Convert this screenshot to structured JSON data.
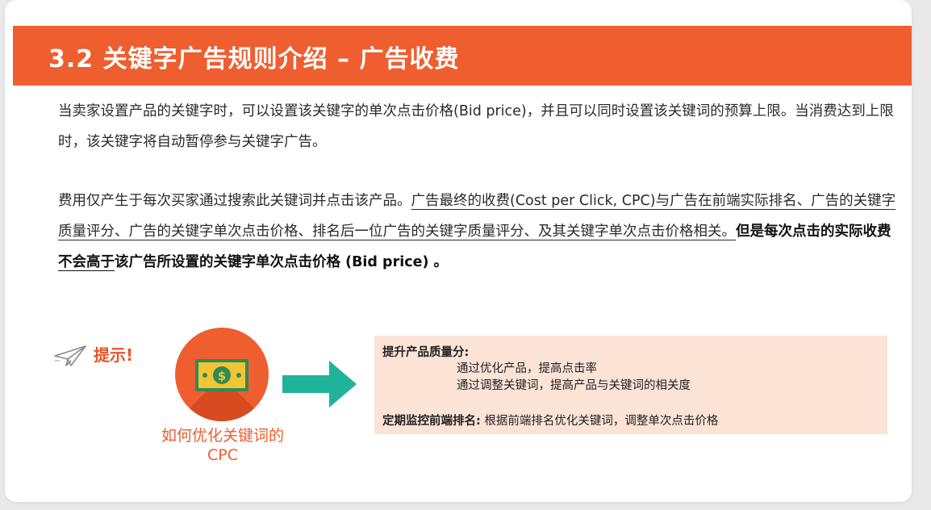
{
  "slide": {
    "title": "3.2 关键字广告规则介绍 – 广告收费",
    "paragraph1": "当卖家设置产品的关键字时，可以设置该关键字的单次点击价格(Bid price)，并且可以同时设置该关键词的预算上限。当消费达到上限时，该关键字将自动暂停参与关键字广告。",
    "paragraph2": {
      "plain": "费用仅产生于每次买家通过搜索此关键词并点击该产品。",
      "underlined": "广告最终的收费(Cost per Click, CPC)与广告在前端实际排名、广告的关键字质量评分、广告的关键字单次点击价格、排名后一位广告的关键字质量评分、及其关键字单次点击价格相关。",
      "bold_a": "但是每次点击的实际收费",
      "bold_underlined": "不会高于",
      "bold_b": "该广告所设置的关键字单次点击价格 (Bid price) 。"
    },
    "tip": {
      "label": "提示!",
      "icon": "paper-plane-icon",
      "caption_line1": "如何优化关键词的",
      "caption_line2": "CPC",
      "money_icon": "money-bill-icon",
      "arrow_icon": "right-arrow-icon"
    },
    "tip_box": {
      "heading1": "提升产品质量分:",
      "item1": "通过优化产品，提高点击率",
      "item2": "通过调整关键词，提高产品与关键词的相关度",
      "heading2": "定期监控前端排名:",
      "line2_text": " 根据前端排名优化关键词，调整单次点击价格"
    },
    "colors": {
      "accent": "#ee5e2f",
      "tip_box_bg": "#fbe3d6",
      "arrow": "#1fb39a",
      "money": "#f2c537"
    }
  }
}
